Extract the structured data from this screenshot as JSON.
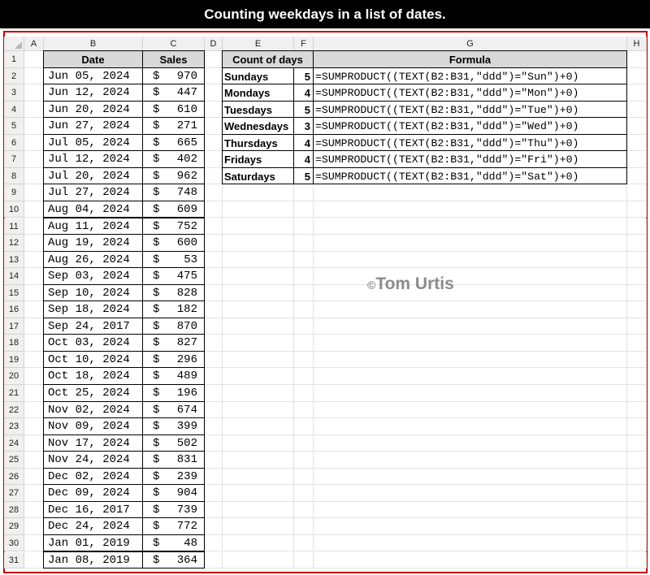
{
  "title": "Counting weekdays in a list of dates.",
  "watermark": "Tom Urtis",
  "watermark_symbol": "©",
  "columns": [
    "A",
    "B",
    "C",
    "D",
    "E",
    "F",
    "G",
    "H"
  ],
  "rows": [
    "1",
    "2",
    "3",
    "4",
    "5",
    "6",
    "7",
    "8",
    "9",
    "10",
    "11",
    "12",
    "13",
    "14",
    "15",
    "16",
    "17",
    "18",
    "19",
    "20",
    "21",
    "22",
    "23",
    "24",
    "25",
    "26",
    "27",
    "28",
    "29",
    "30",
    "31"
  ],
  "sales_table": {
    "headers": [
      "Date",
      "Sales"
    ],
    "currency": "$",
    "data": [
      {
        "date": "Jun 05, 2024",
        "sales": "970"
      },
      {
        "date": "Jun 12, 2024",
        "sales": "447"
      },
      {
        "date": "Jun 20, 2024",
        "sales": "610"
      },
      {
        "date": "Jun 27, 2024",
        "sales": "271"
      },
      {
        "date": "Jul 05, 2024",
        "sales": "665"
      },
      {
        "date": "Jul 12, 2024",
        "sales": "402"
      },
      {
        "date": "Jul 20, 2024",
        "sales": "962"
      },
      {
        "date": "Jul 27, 2024",
        "sales": "748"
      },
      {
        "date": "Aug 04, 2024",
        "sales": "609"
      },
      {
        "date": "Aug 11, 2024",
        "sales": "752"
      },
      {
        "date": "Aug 19, 2024",
        "sales": "600"
      },
      {
        "date": "Aug 26, 2024",
        "sales": "53"
      },
      {
        "date": "Sep 03, 2024",
        "sales": "475"
      },
      {
        "date": "Sep 10, 2024",
        "sales": "828"
      },
      {
        "date": "Sep 18, 2024",
        "sales": "182"
      },
      {
        "date": "Sep 24, 2017",
        "sales": "870"
      },
      {
        "date": "Oct 03, 2024",
        "sales": "827"
      },
      {
        "date": "Oct 10, 2024",
        "sales": "296"
      },
      {
        "date": "Oct 18, 2024",
        "sales": "489"
      },
      {
        "date": "Oct 25, 2024",
        "sales": "196"
      },
      {
        "date": "Nov 02, 2024",
        "sales": "674"
      },
      {
        "date": "Nov 09, 2024",
        "sales": "399"
      },
      {
        "date": "Nov 17, 2024",
        "sales": "502"
      },
      {
        "date": "Nov 24, 2024",
        "sales": "831"
      },
      {
        "date": "Dec 02, 2024",
        "sales": "239"
      },
      {
        "date": "Dec 09, 2024",
        "sales": "904"
      },
      {
        "date": "Dec 16, 2017",
        "sales": "739"
      },
      {
        "date": "Dec 24, 2024",
        "sales": "772"
      },
      {
        "date": "Jan 01, 2019",
        "sales": "48"
      },
      {
        "date": "Jan 08, 2019",
        "sales": "364"
      }
    ]
  },
  "count_table": {
    "headers": [
      "Count of days",
      "Formula"
    ],
    "data": [
      {
        "day": "Sundays",
        "count": "5",
        "formula": "=SUMPRODUCT((TEXT(B2:B31,\"ddd\")=\"Sun\")+0)"
      },
      {
        "day": "Mondays",
        "count": "4",
        "formula": "=SUMPRODUCT((TEXT(B2:B31,\"ddd\")=\"Mon\")+0)"
      },
      {
        "day": "Tuesdays",
        "count": "5",
        "formula": "=SUMPRODUCT((TEXT(B2:B31,\"ddd\")=\"Tue\")+0)"
      },
      {
        "day": "Wednesdays",
        "count": "3",
        "formula": "=SUMPRODUCT((TEXT(B2:B31,\"ddd\")=\"Wed\")+0)"
      },
      {
        "day": "Thursdays",
        "count": "4",
        "formula": "=SUMPRODUCT((TEXT(B2:B31,\"ddd\")=\"Thu\")+0)"
      },
      {
        "day": "Fridays",
        "count": "4",
        "formula": "=SUMPRODUCT((TEXT(B2:B31,\"ddd\")=\"Fri\")+0)"
      },
      {
        "day": "Saturdays",
        "count": "5",
        "formula": "=SUMPRODUCT((TEXT(B2:B31,\"ddd\")=\"Sat\")+0)"
      }
    ]
  }
}
